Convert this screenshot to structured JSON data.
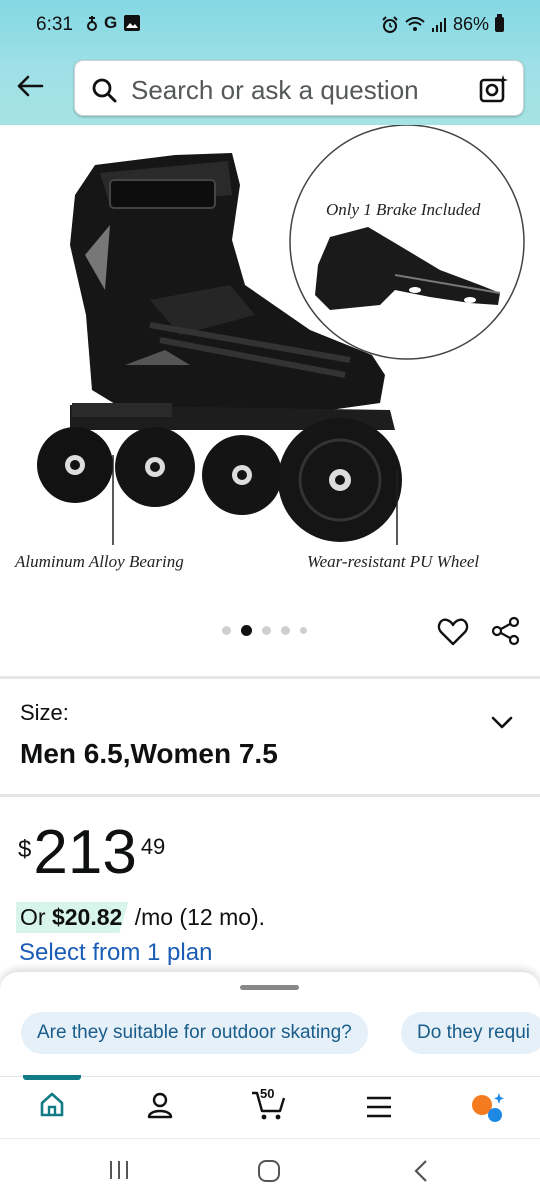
{
  "status_bar": {
    "time": "6:31",
    "left_icons": [
      "notification-icon",
      "G",
      "gallery-icon"
    ],
    "battery": "86%"
  },
  "search": {
    "placeholder": "Search or ask a question"
  },
  "product_image": {
    "brake_caption": "Only 1 Brake Included",
    "bearing_caption": "Aluminum Alloy Bearing",
    "wheel_caption": "Wear-resistant PU Wheel",
    "carousel_count": 5,
    "carousel_active_index": 1
  },
  "size": {
    "label": "Size:",
    "value": "Men 6.5,Women 7.5"
  },
  "price": {
    "symbol": "$",
    "whole": "213",
    "fraction": "49"
  },
  "financing": {
    "prefix": "Or ",
    "amount": "$20.82",
    "suffix": " /mo (12 mo).",
    "link": "Select from 1 plan"
  },
  "questions": [
    "Are they suitable for outdoor skating?",
    "Do they requi"
  ],
  "bottom_nav": {
    "cart_count": "50",
    "items": [
      "home-icon",
      "account-icon",
      "cart-icon",
      "menu-icon",
      "rufus-icon"
    ]
  },
  "colors": {
    "header_gradient_top": "#84d8e4",
    "link_blue": "#1a5db6",
    "chip_bg": "#e5f0f9",
    "active_tab": "#117b86",
    "financing_highlight": "#d7f5ea"
  }
}
